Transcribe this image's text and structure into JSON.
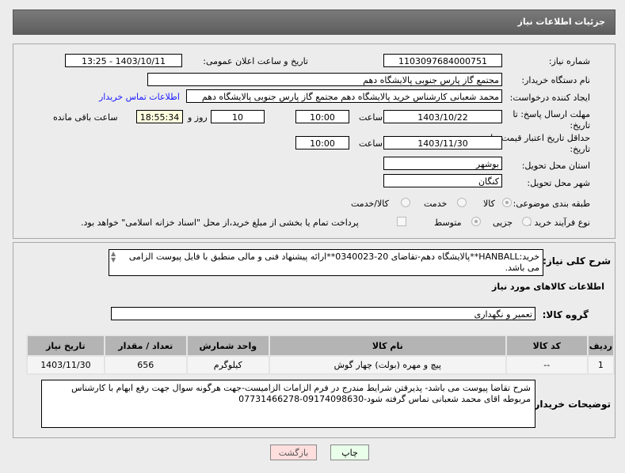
{
  "header": {
    "title": "جزئیات اطلاعات نیاز"
  },
  "form": {
    "need_number_label": "شماره نیاز:",
    "need_number": "1103097684000751",
    "announce_label": "تاریخ و ساعت اعلان عمومی:",
    "announce_value": "1403/10/11 - 13:25",
    "buyer_org_label": "نام دستگاه خریدار:",
    "buyer_org": "مجتمع گاز پارس جنوبی  پالایشگاه دهم",
    "creator_label": "ایجاد کننده درخواست:",
    "creator": "محمد شعبانی کارشناس خرید پالایشگاه دهم  مجتمع گاز پارس جنوبی  پالایشگاه دهم",
    "contact_link": "اطلاعات تماس خریدار",
    "deadline_label_1": "مهلت ارسال پاسخ: تا",
    "deadline_label_2": "تاریخ:",
    "deadline_date": "1403/10/22",
    "time_label": "ساعت",
    "deadline_time": "10:00",
    "days": "10",
    "days_label": "روز و",
    "remaining": "18:55:34",
    "remaining_label": "ساعت باقی مانده",
    "validity_label_1": "حداقل تاریخ اعتبار قیمت: تا",
    "validity_label_2": "تاریخ:",
    "validity_date": "1403/11/30",
    "validity_time": "10:00",
    "province_label": "استان محل تحویل:",
    "province": "بوشهر",
    "city_label": "شهر محل تحویل:",
    "city": "کنگان",
    "category_label": "طبقه بندی موضوعی:",
    "category_options": [
      "کالا",
      "خدمت",
      "کالا/خدمت"
    ],
    "category_selected": "کالا",
    "process_label": "نوع فرآیند خرید :",
    "process_options": [
      "جزیی",
      "متوسط"
    ],
    "payment_note": "پرداخت تمام یا بخشی از مبلغ خرید،از محل \"اسناد خزانه اسلامی\" خواهد بود."
  },
  "description": {
    "label": "شرح کلی نیاز:",
    "text": "خرید:HANBALL**پالایشگاه دهم-تقاضای 20-0340023**ارائه پیشنهاد فنی و مالی منطبق با فایل پیوست الزامی می باشد."
  },
  "goods": {
    "section_title": "اطلاعات کالاهای مورد نیاز",
    "group_label": "گروه کالا:",
    "group": "تعمیر و نگهداری",
    "columns": [
      "ردیف",
      "کد کالا",
      "نام کالا",
      "واحد شمارش",
      "تعداد / مقدار",
      "تاریخ نیاز"
    ],
    "rows": [
      [
        "1",
        "--",
        "پیچ و مهره (بولت) چهار گوش",
        "کیلوگرم",
        "656",
        "1403/11/30"
      ]
    ]
  },
  "buyer_notes": {
    "label": "توضیحات خریدار:",
    "text": "شرح تقاضا پیوست می باشد- پذیرفتن شرایط مندرج در فرم الزامات الزامیست-جهت هرگونه سوال جهت رفع ابهام با کارشناس مربوطه اقای محمد شعبانی تماس گرفته شود-09174098630-07731466278"
  },
  "buttons": {
    "print": "چاپ",
    "back": "بازگشت"
  },
  "watermark": "AriaTender.neT"
}
